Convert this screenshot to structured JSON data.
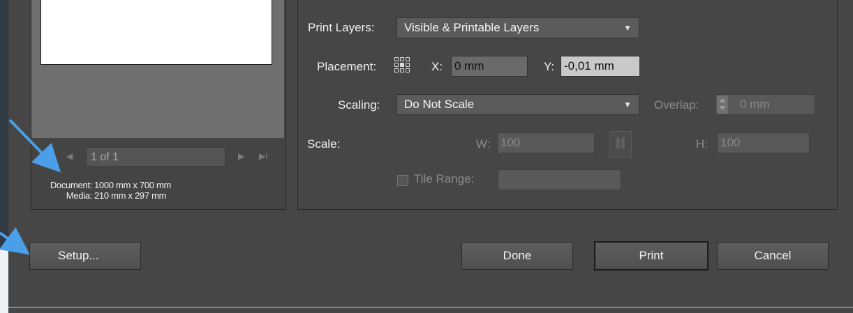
{
  "preview": {
    "page_indicator": "1 of 1",
    "nav": {
      "prev": "◀",
      "next": "▶",
      "last": "▶I"
    },
    "document_label": "Document:",
    "document_value": "1000  mm x 700 mm",
    "media_label": "Media:",
    "media_value": "210  mm x 297 mm"
  },
  "options": {
    "print_layers_label": "Print Layers:",
    "print_layers_value": "Visible & Printable Layers",
    "placement_label": "Placement:",
    "x_label": "X:",
    "x_value": "0 mm",
    "y_label": "Y:",
    "y_value": "-0,01 mm",
    "scaling_label": "Scaling:",
    "scaling_value": "Do Not Scale",
    "overlap_label": "Overlap:",
    "overlap_value": "0 mm",
    "scale_label": "Scale:",
    "w_label": "W:",
    "w_value": "100",
    "h_label": "H:",
    "h_value": "100",
    "tile_range_label": "Tile Range:",
    "tile_range_value": ""
  },
  "buttons": {
    "setup": "Setup...",
    "done": "Done",
    "print": "Print",
    "cancel": "Cancel"
  },
  "colors": {
    "dialog_bg": "#464646",
    "annotation_arrow": "#4a9fe8"
  }
}
